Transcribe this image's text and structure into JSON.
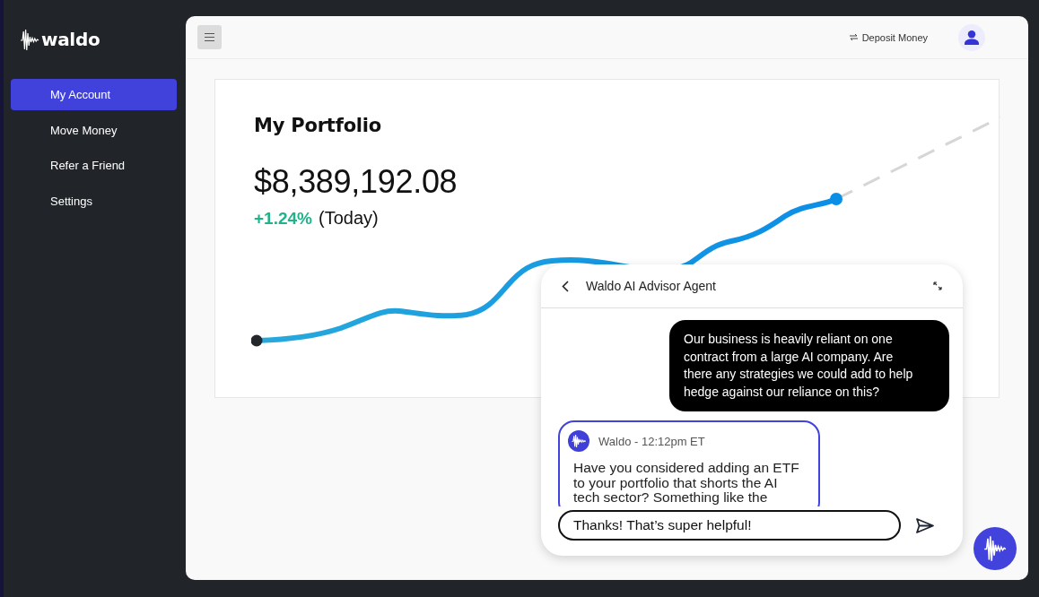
{
  "sidebar": {
    "logo": "waldo",
    "items": [
      {
        "label": "My Account",
        "selected": true
      },
      {
        "label": "Move Money",
        "selected": false
      },
      {
        "label": "Refer a Friend",
        "selected": false
      },
      {
        "label": "Settings",
        "selected": false
      }
    ]
  },
  "top_bar": {
    "action": "Deposit Money"
  },
  "portfolio": {
    "title": "My Portfolio",
    "balance": "$8,389,192.08",
    "change": "+1.24%",
    "period": "(Today)"
  },
  "chat": {
    "title": "Waldo AI Advisor Agent",
    "messages": [
      {
        "kind": "user",
        "text": "Our business is heavily reliant on one contract from a large AI company. Are there any strategies we could add to help hedge against our reliance on this?"
      },
      {
        "kind": "agent",
        "meta": "Waldo - 12:12pm ET",
        "text": "Have you considered adding an ETF to your portfolio that shorts the AI tech sector? Something like the"
      }
    ],
    "input": {
      "value": "Thanks! That’s super helpful!"
    }
  }
}
